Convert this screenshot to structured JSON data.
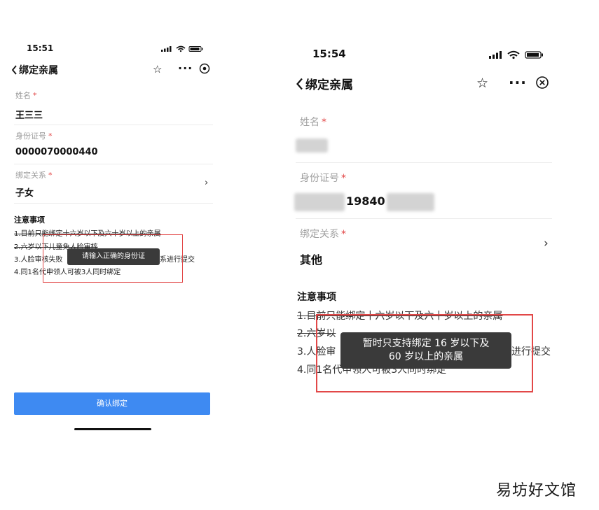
{
  "left": {
    "status_time": "15:51",
    "nav_title": "绑定亲属",
    "form": {
      "name_label": "姓名",
      "name_value": "王三三",
      "id_label": "身份证号",
      "id_value": "0000070000440",
      "relation_label": "绑定关系",
      "relation_value": "子女"
    },
    "notes_title": "注意事项",
    "notes": [
      "1.目前只能绑定十六岁以下及六十岁以上的亲属",
      "2.六岁以下儿童免人脸审核",
      "3.人脸审核失败",
      "系进行提交",
      "4.同1名代申领人可被3人同时绑定"
    ],
    "toast": "请输入正确的身份证",
    "confirm_label": "确认绑定"
  },
  "right": {
    "status_time": "15:54",
    "nav_title": "绑定亲属",
    "form": {
      "name_label": "姓名",
      "id_label": "身份证号",
      "id_value_visible": "19840",
      "relation_label": "绑定关系",
      "relation_value": "其他"
    },
    "notes_title": "注意事项",
    "notes": [
      "1.目前只能绑定十六岁以下及六十岁以上的亲属",
      "2.六岁以",
      "3.人脸审",
      "进行提交",
      "4.同1名代申领人可被3人同时绑定"
    ],
    "toast_line1": "暂时只支持绑定 16 岁以下及",
    "toast_line2": "60 岁以上的亲属"
  },
  "required_mark": "*",
  "watermark": "易坊好文馆",
  "colors": {
    "primary_button": "#3e8af2",
    "required": "#e24848",
    "highlight_box": "#e24848",
    "toast_bg": "#3a3a3a"
  }
}
